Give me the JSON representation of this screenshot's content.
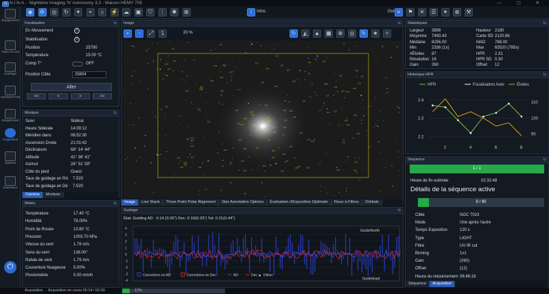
{
  "window": {
    "title": "N.I.N.A. - Nighttime Imaging 'N' Astronomy 3.2  -  Maison HEMY 705",
    "logo": "N"
  },
  "topbar": {
    "icons": [
      "camera-icon",
      "filter-wheel-icon",
      "focuser-icon",
      "rotator-icon",
      "telescope-icon",
      "guider-icon",
      "dome-icon",
      "switch-icon",
      "weather-icon",
      "flat-panel-icon",
      "safety-monitor-icon",
      "hub-icon",
      "plugins-icon",
      "extra-icon"
    ],
    "infos_label": "Infos",
    "outils_label": "Outils"
  },
  "leftnav": [
    {
      "label": "Équipement",
      "icon": "equipment-icon"
    },
    {
      "label": "Atlas du ciel",
      "icon": "sky-atlas-icon"
    },
    {
      "label": "Cadrage",
      "icon": "framing-icon"
    },
    {
      "label": "Assistant Flat",
      "icon": "flat-wizard-icon"
    },
    {
      "label": "Séquenceur",
      "icon": "sequencer-icon"
    },
    {
      "label": "Acquisition",
      "icon": "imaging-icon",
      "active": true
    },
    {
      "label": "Options",
      "icon": "options-icon"
    },
    {
      "label": "Extension",
      "icon": "plugin-icon"
    }
  ],
  "focuser": {
    "title": "Focalisation",
    "rows": [
      {
        "label": "En Mouvement",
        "value": "ⓧ"
      },
      {
        "label": "Stabilisation",
        "value": "ⓧ"
      },
      {
        "label": "Position",
        "value": "25790"
      },
      {
        "label": "Température",
        "value": "15.00 °C"
      },
      {
        "label": "Comp T°",
        "value": "OFF"
      },
      {
        "label": "Position Cible",
        "value": "25804"
      }
    ],
    "move_label": "Aller",
    "steps": [
      "<<",
      "<",
      ">",
      ">>"
    ]
  },
  "mount": {
    "title": "Monture",
    "rows": [
      {
        "label": "Suivi",
        "value": "Sidéral"
      },
      {
        "label": "Heure Sidérale",
        "value": "14:09:12"
      },
      {
        "label": "Méridien dans",
        "value": "06:52:30"
      },
      {
        "label": "Ascension Droite",
        "value": "21:01:42"
      },
      {
        "label": "Déclinaison",
        "value": "68° 14' 44\""
      },
      {
        "label": "Altitude",
        "value": "41° 36' 41\""
      },
      {
        "label": "Azimut",
        "value": "28° 51' 59\""
      },
      {
        "label": "Côté du pied",
        "value": "Ouest"
      },
      {
        "label": "Taux de guidage en RA",
        "value": "7.520"
      },
      {
        "label": "Taux de guidage en Dé",
        "value": "7.520"
      }
    ],
    "tabs": [
      "Caméra",
      "Monture"
    ]
  },
  "weather": {
    "title": "Météo",
    "rows": [
      {
        "label": "Température",
        "value": "17.40 °C"
      },
      {
        "label": "Humidité",
        "value": "78.00%"
      },
      {
        "label": "Point de Rosée",
        "value": "13.60 °C"
      },
      {
        "label": "Pression",
        "value": "1003.70 hPa"
      },
      {
        "label": "Vitesse du vent",
        "value": "1.76 m/s"
      },
      {
        "label": "Sens du vent",
        "value": "138.00°"
      },
      {
        "label": "Rafale de vent",
        "value": "1.75 m/s"
      },
      {
        "label": "Couverture Nuageuse",
        "value": "5.00%"
      },
      {
        "label": "Pluviométrie",
        "value": "0.00 mm/h"
      }
    ]
  },
  "image": {
    "title": "Image",
    "zoom": "20 %",
    "tabs": [
      "Image",
      "Live Stack",
      "Three Point Polar Alignment",
      "Star Annotation Options",
      "Évaluation d'Exposition Optimale",
      "Roue à Filtres",
      "Orbitals"
    ]
  },
  "guiding": {
    "title": "Guidage",
    "stats": "État: Guiding  AD : 0.14 (0.30\")  Dec: 0.16(0.33\")  Tot: 0.21(0.44\")",
    "north": "GuideNorth",
    "east": "GuideEast",
    "legend": [
      "Corrections en AD",
      "Corrections en Dec",
      "AD",
      "Dec",
      "Dither"
    ],
    "yticks": [
      "4",
      "3",
      "2",
      "1",
      "0",
      "-1",
      "-2",
      "-3",
      "-4"
    ]
  },
  "stats": {
    "title": "Statistiques",
    "left": [
      {
        "label": "Largeur",
        "value": "3856"
      },
      {
        "label": "Moyenne",
        "value": "7493.43"
      },
      {
        "label": "Médiane",
        "value": "8256.00"
      },
      {
        "label": "Min",
        "value": "2336 (1x)"
      },
      {
        "label": "#Étoiles",
        "value": "87"
      },
      {
        "label": "Résolution",
        "value": "16"
      },
      {
        "label": "Gain",
        "value": "260"
      }
    ],
    "right": [
      {
        "label": "Hauteur",
        "value": "2180"
      },
      {
        "label": "Carte SD",
        "value": "2120.86"
      },
      {
        "label": "MAD",
        "value": "768.00"
      },
      {
        "label": "Max",
        "value": "65520 (785x)"
      },
      {
        "label": "HFR",
        "value": "2.31"
      },
      {
        "label": "HFR SD",
        "value": "0.30"
      },
      {
        "label": "Offset",
        "value": "12"
      }
    ]
  },
  "hfr": {
    "title": "Historique HFR",
    "legend": [
      "HFR",
      "Focalisation Auto",
      "Étoiles"
    ],
    "yleft": [
      "2.4",
      "2.3",
      "2.2"
    ],
    "yright": [
      "110",
      "100",
      "90"
    ],
    "xticks": [
      "2",
      "4",
      "6",
      "8"
    ]
  },
  "chart_data": {
    "type": "line",
    "x": [
      1,
      2,
      3,
      4,
      5,
      6,
      7,
      8
    ],
    "series": [
      {
        "name": "HFR",
        "values": [
          2.37,
          2.36,
          2.29,
          2.22,
          2.31,
          2.33,
          2.38,
          2.31
        ]
      },
      {
        "name": "Étoiles",
        "values": [
          104,
          112,
          101,
          104,
          100,
          95,
          97,
          89
        ]
      }
    ],
    "ylim": [
      2.18,
      2.44
    ],
    "y2lim": [
      86,
      116
    ],
    "xlim": [
      0.6,
      8.6
    ]
  },
  "sequence": {
    "title": "Séquence",
    "progress_text": "1 / 1",
    "progress": 1,
    "end_label": "Heure de fin estimée",
    "end_value": "02:32:48",
    "active_title": "Détails de la séquence active",
    "sub_progress_text": "8 / 90",
    "sub_progress": 0.089,
    "rows": [
      {
        "label": "Cible",
        "value": "NGC 7023"
      },
      {
        "label": "Mode",
        "value": "Une après l'autre"
      },
      {
        "label": "Temps Exposition",
        "value": "120 s"
      },
      {
        "label": "Type",
        "value": "LIGHT"
      },
      {
        "label": "Filtre",
        "value": "UV IR cut"
      },
      {
        "label": "Binning",
        "value": "1x1"
      },
      {
        "label": "Gain",
        "value": "(260)"
      },
      {
        "label": "Offset",
        "value": "(12)"
      },
      {
        "label": "Heure du retournement",
        "value": "06:46:19"
      }
    ],
    "tabs": [
      "Séquence",
      "Acquisition"
    ]
  },
  "status": {
    "left": "Acquisition",
    "text": "Acquisition en cours 00:14 / 02:00",
    "progress_pct": "12%"
  }
}
